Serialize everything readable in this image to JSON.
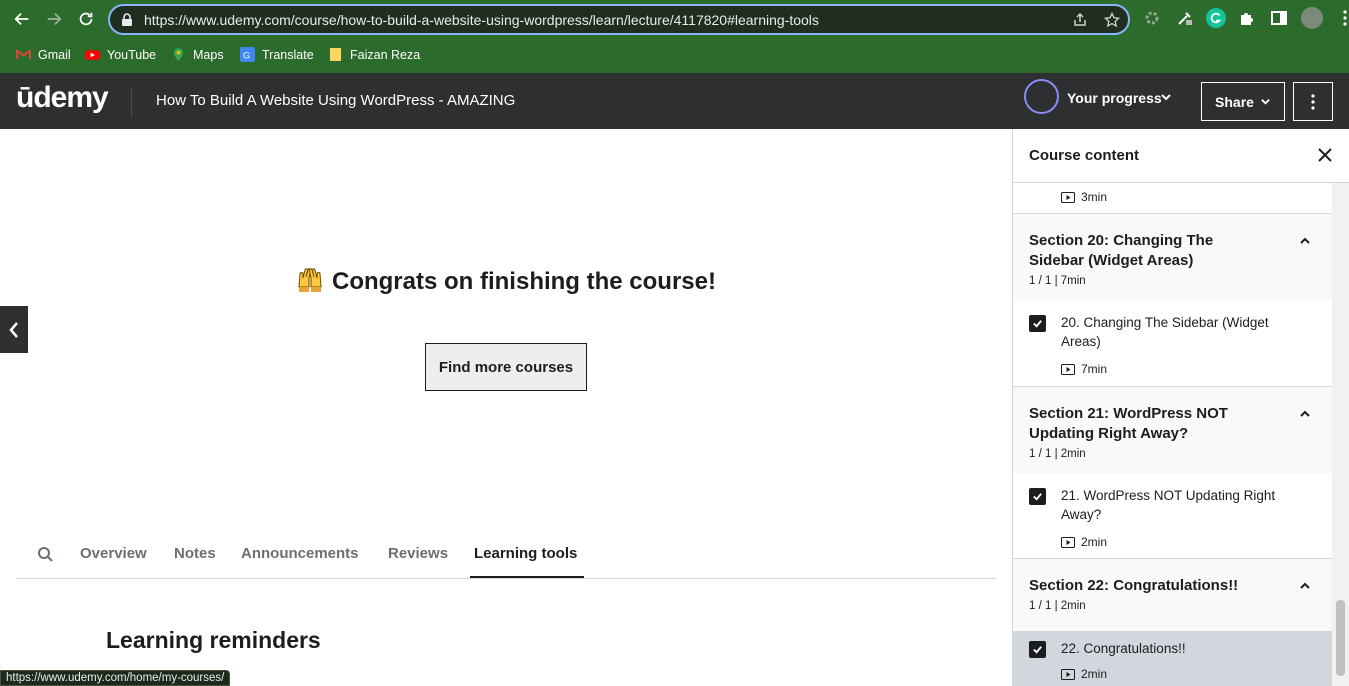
{
  "browser": {
    "url": "https://www.udemy.com/course/how-to-build-a-website-using-wordpress/learn/lecture/4117820#learning-tools",
    "bookmarks": [
      {
        "label": "Gmail",
        "icon": "gmail-icon"
      },
      {
        "label": "YouTube",
        "icon": "youtube-icon"
      },
      {
        "label": "Maps",
        "icon": "maps-icon"
      },
      {
        "label": "Translate",
        "icon": "translate-icon"
      },
      {
        "label": "Faizan Reza",
        "icon": "folder-icon"
      }
    ],
    "status_url": "https://www.udemy.com/home/my-courses/"
  },
  "header": {
    "logo": "ūdemy",
    "course_title": "How To Build A Website Using WordPress - AMAZING",
    "progress_label": "Your progress",
    "share_label": "Share",
    "colors": {
      "bg": "#2d2f31",
      "progress_ring": "#8a8cf8"
    }
  },
  "main": {
    "congrats": "Congrats on finishing the course!",
    "find_button": "Find more courses",
    "tabs": [
      {
        "label": "Overview"
      },
      {
        "label": "Notes"
      },
      {
        "label": "Announcements"
      },
      {
        "label": "Reviews"
      },
      {
        "label": "Learning tools",
        "active": true
      }
    ],
    "section_heading": "Learning reminders"
  },
  "sidebar": {
    "title": "Course content",
    "top_lecture_duration": "3min",
    "sections": [
      {
        "title": "Section 20: Changing The Sidebar (Widget Areas)",
        "meta": "1 / 1 | 7min",
        "lecture": {
          "title": "20. Changing The Sidebar (Widget Areas)",
          "duration": "7min",
          "completed": true
        }
      },
      {
        "title": "Section 21: WordPress NOT Updating Right Away?",
        "meta": "1 / 1 | 2min",
        "lecture": {
          "title": "21. WordPress NOT Updating Right Away?",
          "duration": "2min",
          "completed": true
        }
      },
      {
        "title": "Section 22: Congratulations!!",
        "meta": "1 / 1 | 2min",
        "lecture": {
          "title": "22. Congratulations!!",
          "duration": "2min",
          "completed": true,
          "current": true
        }
      }
    ]
  }
}
